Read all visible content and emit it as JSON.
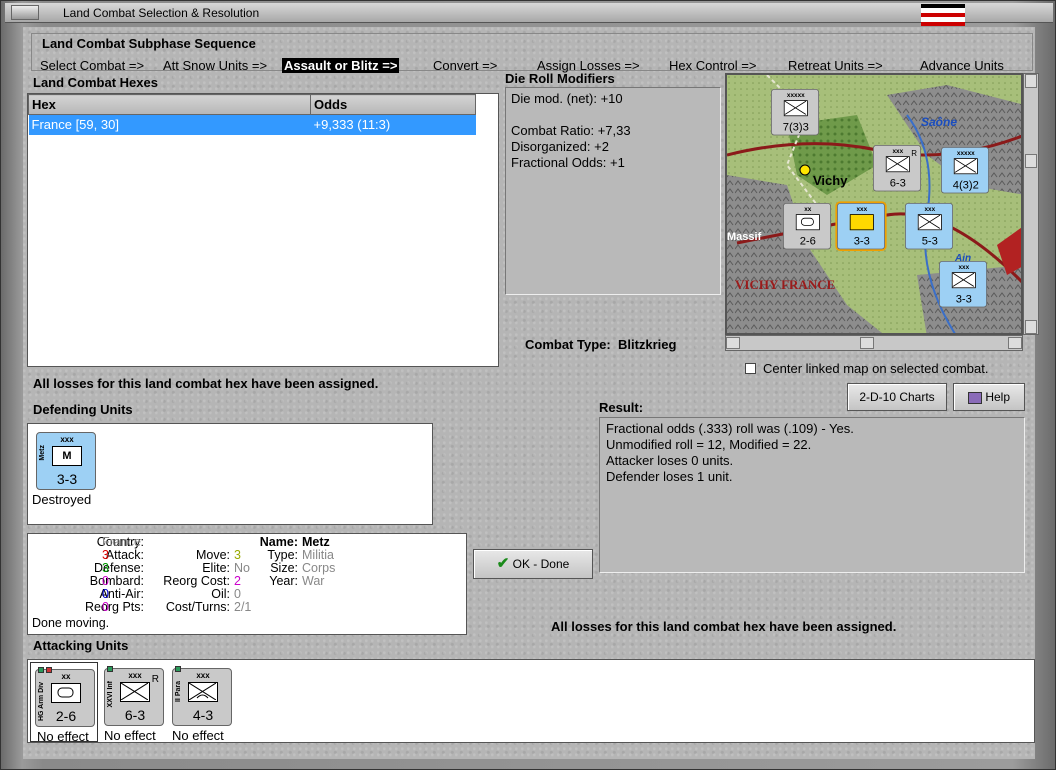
{
  "window": {
    "title": "Land Combat Selection & Resolution"
  },
  "subphase": {
    "title": "Land Combat Subphase Sequence",
    "steps": [
      "Select Combat =>",
      "Att Snow Units =>",
      "Assault or Blitz =>",
      "Convert =>",
      "Assign Losses =>",
      "Hex Control =>",
      "Retreat Units =>",
      "Advance Units"
    ],
    "active_step": "Assault or Blitz =>"
  },
  "combat_hexes": {
    "title": "Land Combat Hexes",
    "columns": [
      "Hex",
      "Odds"
    ],
    "rows": [
      {
        "hex": "France [59, 30]",
        "odds": "+9,333 (11:3)"
      }
    ]
  },
  "modifiers": {
    "title": "Die Roll Modifiers",
    "net": "Die mod. (net): +10",
    "lines": [
      "Combat Ratio: +7,33",
      "Disorganized: +2",
      "Fractional Odds: +1"
    ]
  },
  "combat_type": {
    "label": "Combat Type:",
    "value": "Blitzkrieg"
  },
  "map": {
    "labels": {
      "vichy": "Vichy",
      "saone": "Saône",
      "massif": "Massif",
      "vichy_france": "VICHY FRANCE",
      "ain": "Ain"
    },
    "center_label": "Center linked map on selected combat."
  },
  "status_msg": "All losses for this land combat hex have been assigned.",
  "buttons": {
    "charts": "2-D-10 Charts",
    "help": "Help",
    "ok": "OK - Done"
  },
  "defending": {
    "title": "Defending Units",
    "units": [
      {
        "size": "xxx",
        "name": "Metz",
        "symbol": "M",
        "value": "3-3",
        "status": "Destroyed"
      }
    ]
  },
  "unit_info": {
    "country_label": "Country:",
    "country": "France",
    "attack_label": "Attack:",
    "attack": "3",
    "defense_label": "Defense:",
    "defense": "3",
    "bombard_label": "Bombard:",
    "bombard": "0",
    "antiair_label": "Anti-Air:",
    "antiair": "0",
    "reorgpts_label": "Reorg Pts:",
    "reorgpts": "0",
    "move_label": "Move:",
    "move": "3",
    "elite_label": "Elite:",
    "elite": "No",
    "reorgcost_label": "Reorg Cost:",
    "reorgcost": "2",
    "oil_label": "Oil:",
    "oil": "0",
    "costturns_label": "Cost/Turns:",
    "costturns": "2/1",
    "name_label": "Name:",
    "name": "Metz",
    "type_label": "Type:",
    "type": "Militia",
    "size_label": "Size:",
    "size": "Corps",
    "year_label": "Year:",
    "year": "War",
    "done": "Done moving."
  },
  "result": {
    "title": "Result:",
    "lines": [
      "Fractional odds (.333) roll was (.109)  - Yes.",
      "Unmodified roll = 12, Modified = 22.",
      "Attacker loses 0 units.",
      "Defender loses 1 unit."
    ]
  },
  "attacking": {
    "title": "Attacking Units",
    "units": [
      {
        "size": "xx",
        "name": "HG Arm Div",
        "value": "2-6",
        "status": "No effect"
      },
      {
        "size": "xxx",
        "name": "XXVI Inf",
        "value": "6-3",
        "tag": "R",
        "status": "No effect"
      },
      {
        "size": "xxx",
        "name": "II Para",
        "value": "4-3",
        "status": "No effect"
      }
    ]
  },
  "map_counters": [
    {
      "size": "xxxxx",
      "value": "7(3)3"
    },
    {
      "size": "xxx",
      "value": "6-3",
      "tag": "R"
    },
    {
      "size": "xxxxx",
      "value": "4(3)2"
    },
    {
      "size": "xx",
      "value": "2-6"
    },
    {
      "size": "xxx",
      "value": "3-3"
    },
    {
      "size": "xxx",
      "value": "5-3"
    },
    {
      "size": "xxx",
      "value": "3-3"
    }
  ]
}
